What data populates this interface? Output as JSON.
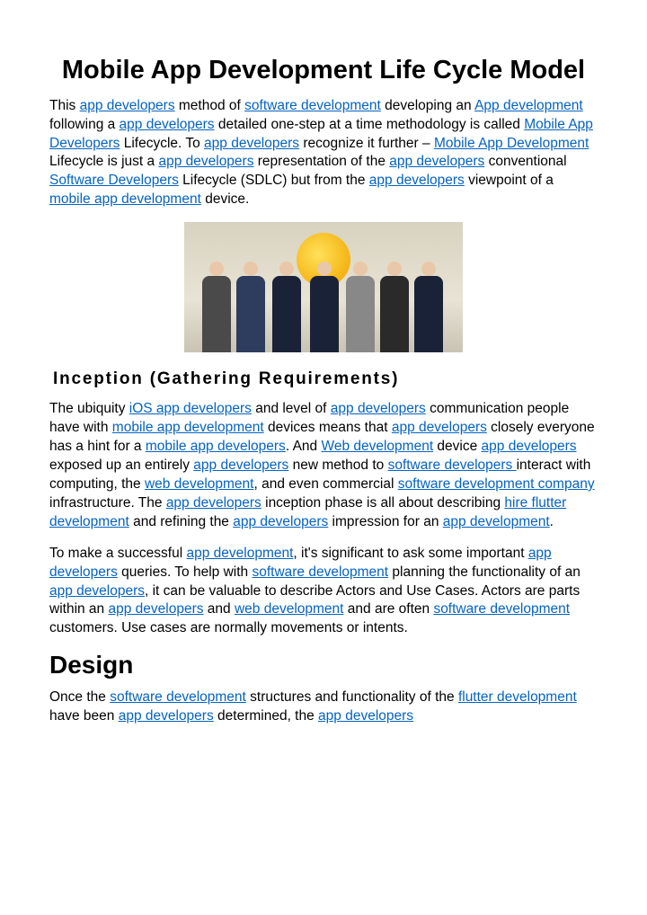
{
  "title": "Mobile App Development Life Cycle Model",
  "p1": {
    "t1": "This ",
    "l1": "app developers",
    "t2": " method of ",
    "l2": "software development",
    "t3": " developing an ",
    "l3": "App development",
    "t4": " following a ",
    "l4": "app developers",
    "t5": " detailed one-step at a time methodology is called ",
    "l5": "Mobile App Developers",
    "t6": " Lifecycle. To ",
    "l6": "app developers",
    "t7": " recognize it further – ",
    "l7": "Mobile App Development",
    "t8": " Lifecycle is just a ",
    "l8": "app developers",
    "t9": " representation of the ",
    "l9": "app developers",
    "t10": " conventional ",
    "l10": "Software Developers",
    "t11": " Lifecycle (SDLC) but from the ",
    "l11": "app developers",
    "t12": " viewpoint of a ",
    "l12": "mobile app development",
    "t13": " device."
  },
  "h2a": "Inception (Gathering Requirements)",
  "p2": {
    "t1": "The ubiquity ",
    "l1": "iOS app developers",
    "t2": " and level of ",
    "l2": "app developers",
    "t3": " communication people have with ",
    "l3": "mobile app development",
    "t4": " devices means that ",
    "l4": "app developers",
    "t5": " closely everyone has a hint for a ",
    "l5": "mobile app developers",
    "t6": ". And ",
    "l6": "Web development",
    "t7": " device ",
    "l7": "app developers",
    "t8": " exposed up an entirely ",
    "l8": "app developers",
    "t9": " new method to ",
    "l9": "software developers ",
    "t10": " interact with computing, the ",
    "l10": "web development",
    "t11": ", and even commercial ",
    "l11": "software development company",
    "t12": " infrastructure. The ",
    "l12": "app developers",
    "t13": " inception phase is all about describing ",
    "l13": "hire flutter development",
    "t14": " and refining the ",
    "l14": "app developers",
    "t15": " impression for an ",
    "l15": "app development",
    "t16": "."
  },
  "p3": {
    "t1": "To make a successful ",
    "l1": "app development",
    "t2": ", it's significant to ask some important ",
    "l2": "app developers",
    "t3": " queries.  To help with ",
    "l3": "software development",
    "t4": " planning the functionality of an ",
    "l4": "app developers",
    "t5": ", it can be valuable to describe Actors and Use Cases. Actors are parts within an ",
    "l5": "app developers",
    "t6": " and ",
    "l6": "web development",
    "t7": " and are often ",
    "l7": "software development",
    "t8": " customers. Use cases are normally movements or intents."
  },
  "h2b": "Design",
  "p4": {
    "t1": "Once the ",
    "l1": "software development",
    "t2": " structures and functionality of the ",
    "l2": "flutter development",
    "t3": " have been ",
    "l3": "app developers",
    "t4": " determined, the ",
    "l4": "app developers"
  }
}
